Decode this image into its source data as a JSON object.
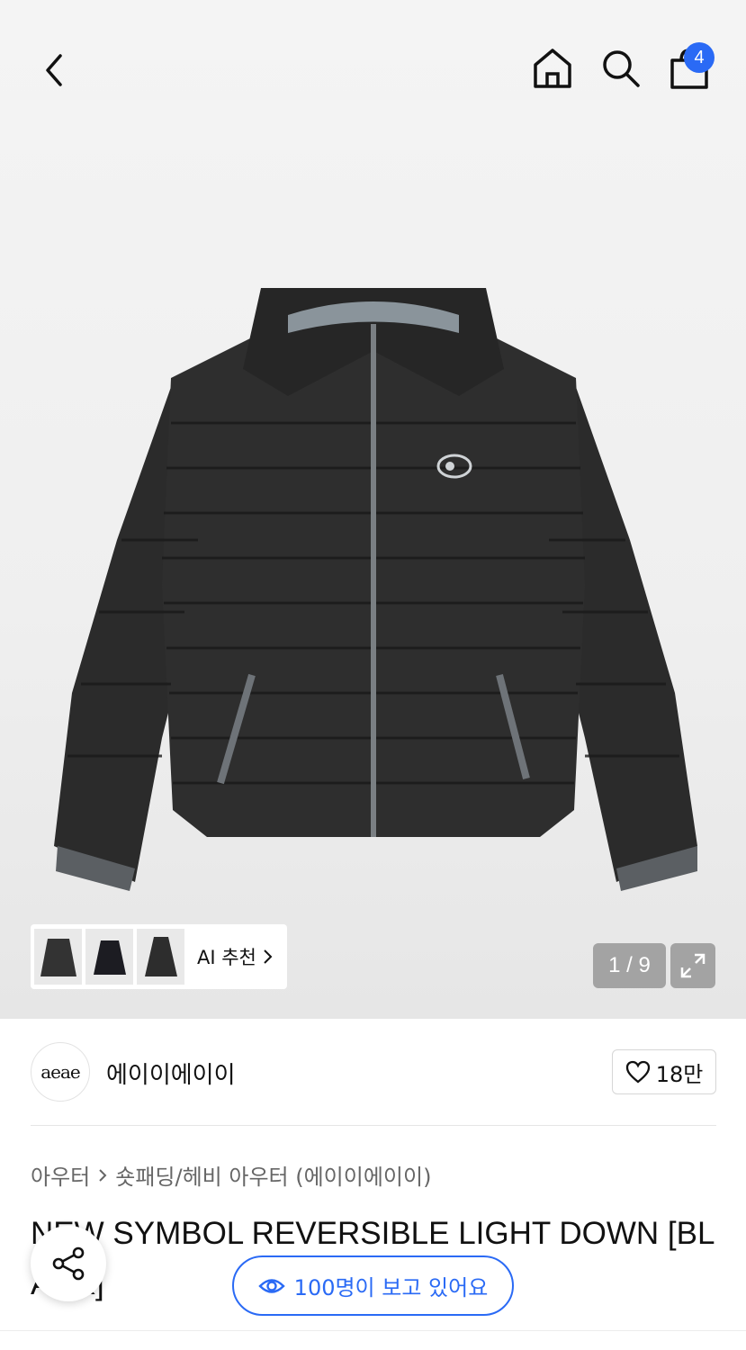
{
  "topbar": {
    "back_icon": "chevron-left-icon",
    "home_icon": "home-icon",
    "search_icon": "search-icon",
    "cart_icon": "shopping-bag-icon",
    "cart_count": "4"
  },
  "gallery": {
    "ai_recommend_label": "AI 추천",
    "counter": "1 / 9",
    "expand_icon": "expand-icon"
  },
  "brand": {
    "logo_text": "aeae",
    "name": "에이이에이이",
    "like_count": "18만"
  },
  "product": {
    "breadcrumb": [
      "아우터",
      "숏패딩/헤비 아우터 (에이이에이이)"
    ],
    "title": "NEW SYMBOL REVERSIBLE LIGHT DOWN [BLACK]"
  },
  "floating": {
    "viewers_text": "100명이 보고 있어요",
    "share_icon": "share-icon"
  },
  "colors": {
    "accent": "#2a6af5",
    "jacket": "#2b2b2b"
  }
}
